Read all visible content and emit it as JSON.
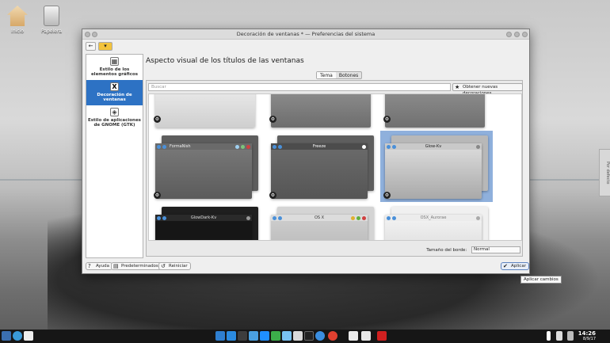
{
  "desktop": {
    "icons": [
      {
        "label": "Inicio",
        "icon": "home-folder-icon"
      },
      {
        "label": "Papelera",
        "icon": "trash-icon"
      }
    ],
    "side_widget": "Por defecto"
  },
  "window": {
    "title": "Decoración de ventanas * — Preferencias del sistema",
    "sidebar": {
      "items": [
        {
          "label": "Estilo de los elementos gráficos",
          "icon": "widget-style-icon"
        },
        {
          "label": "Decoración de ventanas",
          "icon": "x-window-icon",
          "active": true
        },
        {
          "label": "Estilo de aplicaciones de GNOME (GTK)",
          "icon": "gtk-icon"
        }
      ]
    },
    "heading": "Aspecto visual de los títulos de las ventanas",
    "tabs": [
      {
        "label": "Tema",
        "active": true
      },
      {
        "label": "Botones",
        "active": false
      }
    ],
    "search_placeholder": "Buscar",
    "get_new_label": "Obtener nuevas decoraciones...",
    "decorations": [
      {
        "name": "",
        "style": "light"
      },
      {
        "name": "",
        "style": "dark"
      },
      {
        "name": "",
        "style": "dark"
      },
      {
        "name": "FormaNish",
        "style": "gray"
      },
      {
        "name": "Freeze",
        "style": "darkgray"
      },
      {
        "name": "Glow-Kv",
        "style": "silver",
        "selected": true
      },
      {
        "name": "GlowDark-Kv",
        "style": "black"
      },
      {
        "name": "OS X",
        "style": "lightgray"
      },
      {
        "name": "OSX_Aurorae",
        "style": "white"
      }
    ],
    "border_size": {
      "label": "Tamaño del borde:",
      "value": "Normal"
    },
    "buttons": {
      "help": "Ayuda",
      "defaults": "Predeterminados",
      "reset": "Reiniciar",
      "apply": "Aplicar"
    },
    "tooltip": "Aplicar cambios"
  },
  "taskbar": {
    "time": "14:26",
    "date": "8/9/17"
  }
}
